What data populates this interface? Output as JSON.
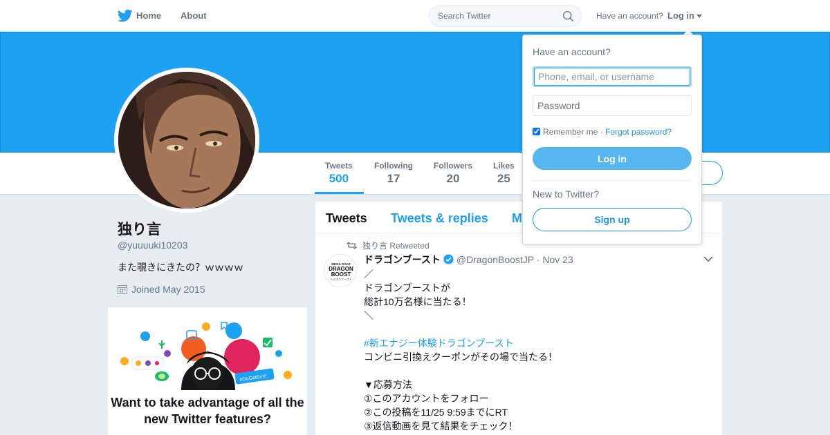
{
  "nav": {
    "home_label": "Home",
    "about_label": "About",
    "search_placeholder": "Search Twitter",
    "account_question": "Have an account?",
    "login_label": "Log in",
    "brand_color": "#1da1f2"
  },
  "profile": {
    "name": "独り言",
    "handle": "@yuuuuki10203",
    "bio": "また覗きにきたの？ｗｗｗｗ",
    "joined": "Joined May 2015",
    "stats": [
      {
        "label": "Tweets",
        "value": "500",
        "active": true
      },
      {
        "label": "Following",
        "value": "17"
      },
      {
        "label": "Followers",
        "value": "20"
      },
      {
        "label": "Likes",
        "value": "25"
      }
    ]
  },
  "promo": {
    "title": "Want to take advantage of all the new Twitter features?",
    "bubble_text": "#GoGetEm!!"
  },
  "timeline": {
    "tabs": [
      "Tweets",
      "Tweets & replies",
      "M"
    ],
    "tweet": {
      "retweet_note": "独り言 Retweeted",
      "author_name": "ドラゴンブースト",
      "author_handle": "@DragonBoostJP",
      "date": "· Nov 23",
      "avatar_text": [
        "MEGA GOLD",
        "DRAGON",
        "BOOST",
        "ドラゴンブースト"
      ],
      "lines": [
        "／",
        "ドラゴンブーストが",
        "総計10万名様に当たる！",
        "＼",
        "",
        "#新エナジー体験ドラゴンブースト",
        "コンビニ引換えクーポンがその場で当たる！",
        "",
        "▼応募方法",
        "①このアカウントをフォロー",
        "②この投稿を11/25 9:59までにRT",
        "③返信動画を見て結果をチェック！"
      ]
    }
  },
  "login_dropdown": {
    "question": "Have an account?",
    "username_placeholder": "Phone, email, or username",
    "password_placeholder": "Password",
    "remember_label": "Remember me",
    "forgot_label": "Forgot password?",
    "remember_checked": true,
    "login_button": "Log in",
    "new_label": "New to Twitter?",
    "signup_button": "Sign up"
  }
}
